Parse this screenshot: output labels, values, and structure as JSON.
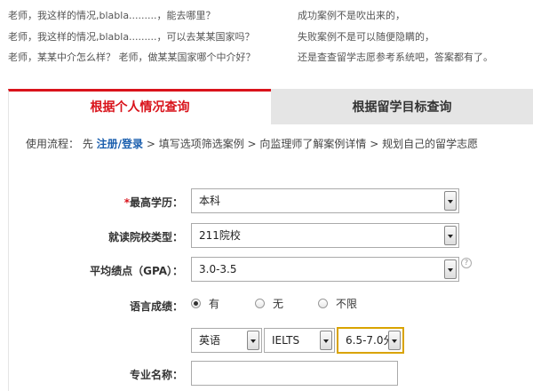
{
  "intro": {
    "left_lines": [
      "老师，我这样的情况,blabla.........，能去哪里？",
      "老师，我这样的情况,blabla.........，可以去某某国家吗？",
      "老师，某某中介怎么样？ 老师，做某某国家哪个中介好？"
    ],
    "right_lines": [
      "成功案例不是吹出来的，",
      "失败案例不是可以随便隐瞒的，",
      "还是查查留学志愿参考系统吧，答案都有了。"
    ]
  },
  "tabs": {
    "active_label": "根据个人情况查询",
    "inactive_label": "根据留学目标查询"
  },
  "flow": {
    "prefix": "使用流程： 先 ",
    "register_link": "注册/登录",
    "rest": " > 填写选项筛选案例 > 向监理师了解案例详情 > 规划自己的留学志愿"
  },
  "form": {
    "education": {
      "required_mark": "*",
      "label": "最高学历：",
      "value": "本科"
    },
    "school_type": {
      "label": "就读院校类型：",
      "value": "211院校"
    },
    "gpa": {
      "label": "平均绩点（GPA）：",
      "value": "3.0-3.5",
      "help": "?"
    },
    "language": {
      "label": "语言成绩：",
      "options": [
        "有",
        "无",
        "不限"
      ],
      "selected": "有",
      "lang_value": "英语",
      "test_value": "IELTS",
      "score_value": "6.5-7.0分"
    },
    "major": {
      "label": "专业名称：",
      "value": ""
    }
  }
}
